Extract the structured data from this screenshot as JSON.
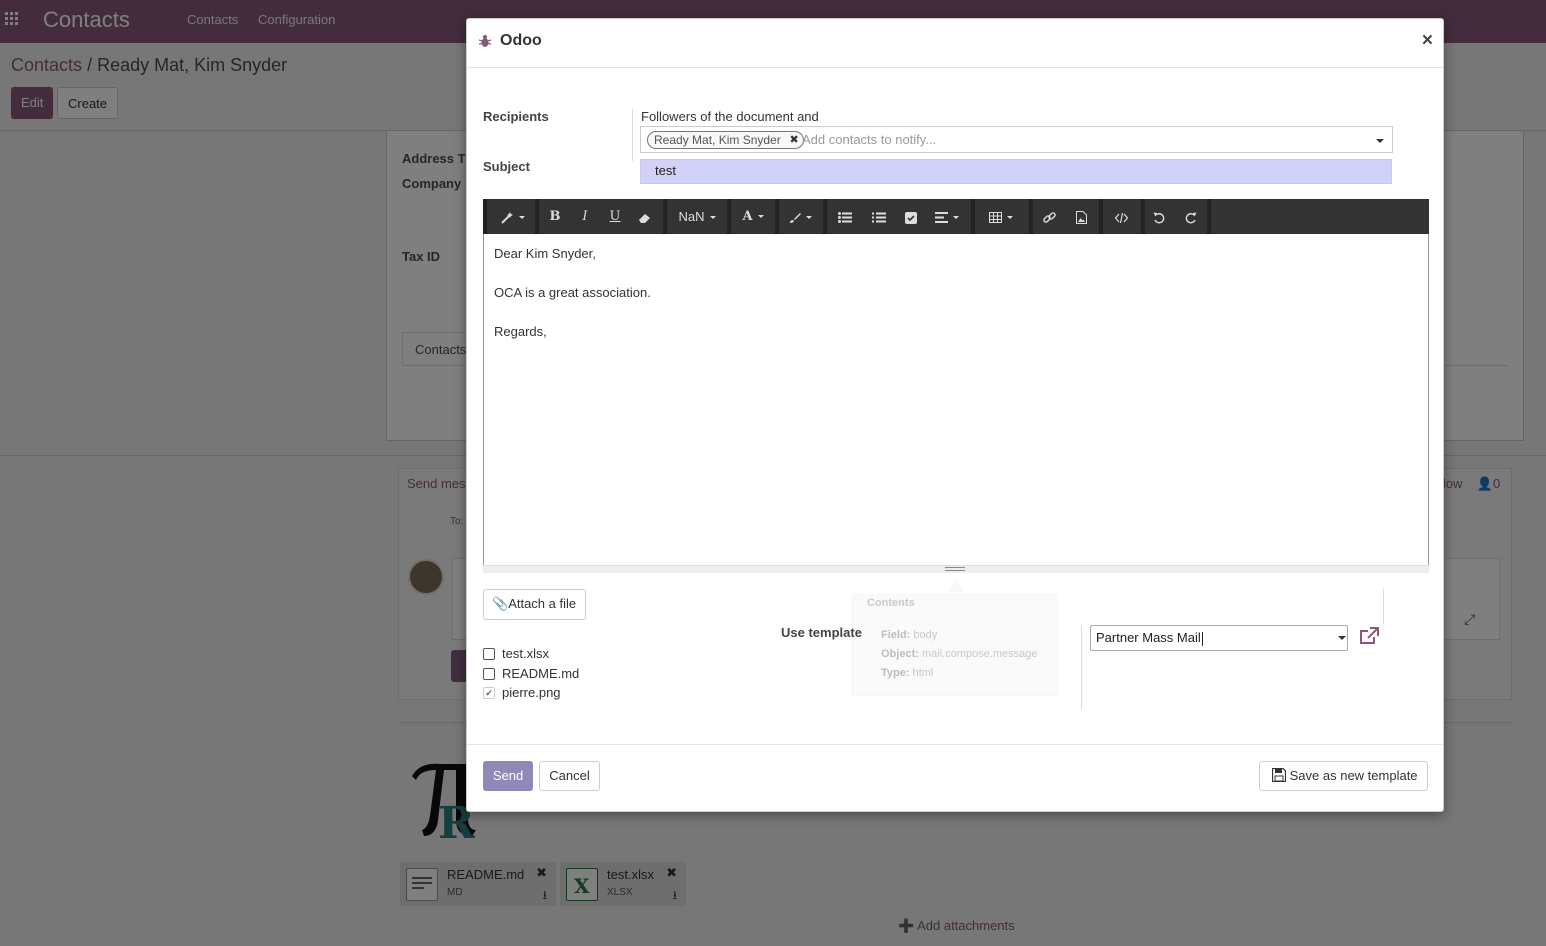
{
  "app": {
    "name": "Contacts",
    "menu": [
      "Contacts",
      "Configuration"
    ],
    "breadcrumb_parent": "Contacts",
    "breadcrumb_sep": "/",
    "breadcrumb_current": "Ready Mat, Kim Snyder",
    "edit_label": "Edit",
    "create_label": "Create"
  },
  "form": {
    "labels": {
      "address_type": "Address T",
      "company": "Company",
      "tax_id": "Tax ID"
    },
    "tab_contacts": "Contacts"
  },
  "chatter": {
    "send_message": "Send mes",
    "follow": "llow",
    "followers_count": "0",
    "to_label": "To:",
    "attachments": [
      {
        "name": "README.md",
        "ext": "MD"
      },
      {
        "name": "test.xlsx",
        "ext": "XLSX"
      }
    ],
    "add_attachments": "Add attachments"
  },
  "dialog": {
    "title": "Odoo",
    "close_glyph": "×",
    "recipients_label": "Recipients",
    "followers_text": "Followers of the document and",
    "recipient_tag": "Ready Mat, Kim Snyder",
    "recipient_placeholder": "Add contacts to notify...",
    "subject_label": "Subject",
    "subject_value": "test",
    "toolbar": {
      "font_size": "NaN"
    },
    "body": [
      "Dear Kim Snyder,",
      "OCA is a great association.",
      "Regards,"
    ],
    "attach_label": "Attach a file",
    "files": [
      {
        "name": "test.xlsx",
        "checked": false
      },
      {
        "name": "README.md",
        "checked": false
      },
      {
        "name": "pierre.png",
        "checked": true
      }
    ],
    "tooltip": {
      "title": "Contents",
      "field_label": "Field:",
      "field_value": "body",
      "object_label": "Object:",
      "object_value": "mail.compose.message",
      "type_label": "Type:",
      "type_value": "html"
    },
    "use_template_label": "Use template",
    "template_value": "Partner Mass Mail",
    "send_label": "Send",
    "cancel_label": "Cancel",
    "save_template_label": "Save as new template"
  },
  "colors": {
    "brand": "#875a7b",
    "send_button": "#8f89b7",
    "subject_bg": "#d2d2f8",
    "toolbar": "#333333"
  }
}
